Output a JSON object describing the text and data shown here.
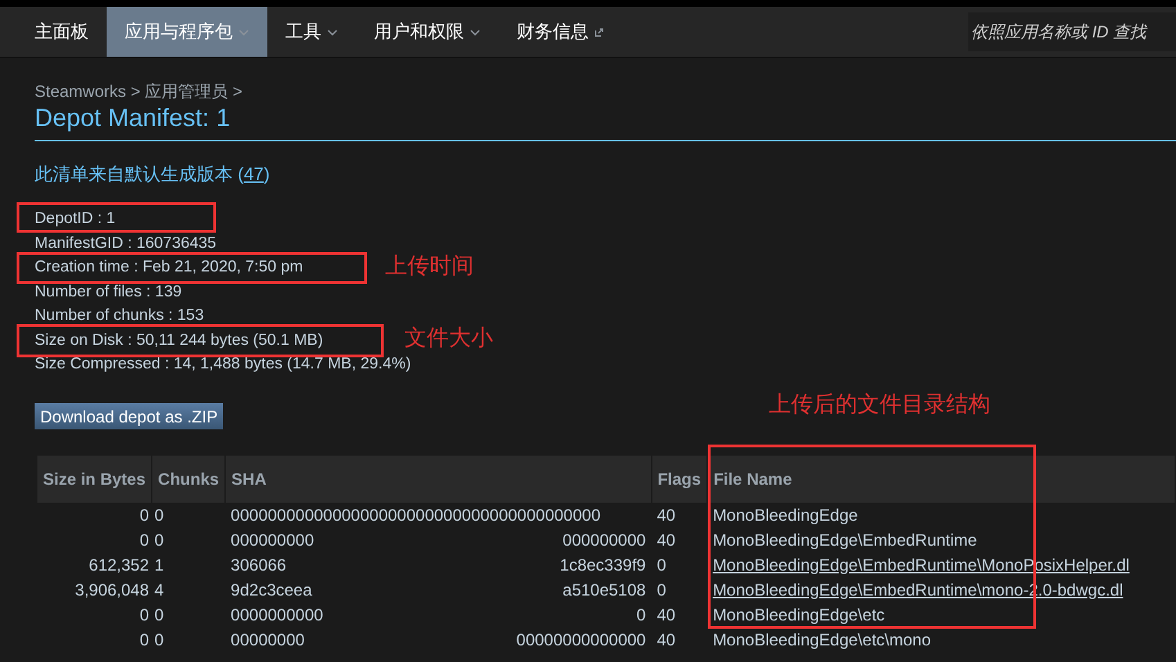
{
  "nav": {
    "items": [
      {
        "label": "主面板",
        "selected": false,
        "kind": "plain"
      },
      {
        "label": "应用与程序包",
        "selected": true,
        "kind": "menu"
      },
      {
        "label": "工具",
        "selected": false,
        "kind": "menu"
      },
      {
        "label": "用户和权限",
        "selected": false,
        "kind": "menu"
      },
      {
        "label": "财务信息",
        "selected": false,
        "kind": "external"
      }
    ],
    "search": {
      "placeholder": "依照应用名称或 ID 查找"
    }
  },
  "breadcrumb": "Steamworks > 应用管理员 >",
  "title": "Depot Manifest: 1",
  "source": {
    "text": "此清单来自默认生成版本 (",
    "link": "47",
    "close": ")"
  },
  "info": [
    "DepotID : 1",
    "ManifestGID : 160736435",
    "Creation time : Feb 21, 2020, 7:50 pm",
    "Number of files : 139",
    "Number of chunks : 153",
    "Size on Disk : 50,11 244 bytes (50.1 MB)",
    "Size Compressed : 14, 1,488 bytes (14.7 MB, 29.4%)"
  ],
  "download_button": "Download depot as .ZIP",
  "table": {
    "columns": [
      "Size in Bytes",
      "Chunks",
      "SHA",
      "Flags",
      "File Name"
    ],
    "rows": [
      {
        "size": "0",
        "chunks": "0",
        "sha": [
          "0000000000000000000000000000000000000000"
        ],
        "flags": "40",
        "file": "MonoBleedingEdge",
        "link": false
      },
      {
        "size": "0",
        "chunks": "0",
        "sha": [
          "000000000",
          "000000000"
        ],
        "flags": "40",
        "file": "MonoBleedingEdge\\EmbedRuntime",
        "link": false
      },
      {
        "size": "612,352",
        "chunks": "1",
        "sha": [
          "306066",
          "1c8ec339f9"
        ],
        "flags": "0",
        "file": "MonoBleedingEdge\\EmbedRuntime\\MonoPosixHelper.dl",
        "link": true
      },
      {
        "size": "3,906,048",
        "chunks": "4",
        "sha": [
          "9d2c3ceea",
          "a510e5108"
        ],
        "flags": "0",
        "file": "MonoBleedingEdge\\EmbedRuntime\\mono-2.0-bdwgc.dl",
        "link": true
      },
      {
        "size": "0",
        "chunks": "0",
        "sha": [
          "0000000000",
          "0"
        ],
        "flags": "40",
        "file": "MonoBleedingEdge\\etc",
        "link": false
      },
      {
        "size": "0",
        "chunks": "0",
        "sha": [
          "00000000",
          "00000000000000"
        ],
        "flags": "40",
        "file": "MonoBleedingEdge\\etc\\mono",
        "link": false
      }
    ]
  },
  "annotations": [
    "上传时间",
    "文件大小",
    "上传后的文件目录结构"
  ]
}
